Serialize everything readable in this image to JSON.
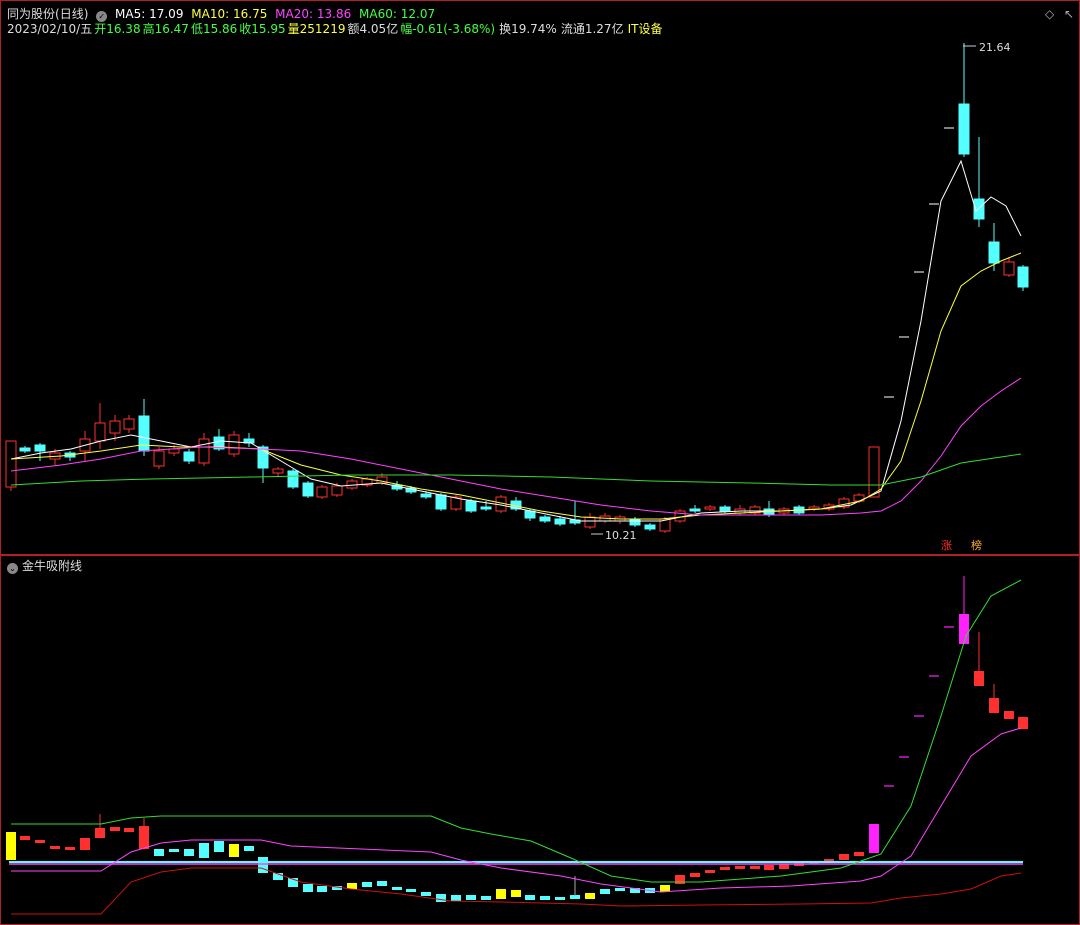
{
  "header": {
    "stock_name": "同为股份",
    "period": "(日线)",
    "ma": [
      {
        "label": "MA5: 17.09",
        "color": "#ffffff"
      },
      {
        "label": "MA10: 16.75",
        "color": "#ffff44"
      },
      {
        "label": "MA20: 13.86",
        "color": "#ff44ff"
      },
      {
        "label": "MA60: 12.07",
        "color": "#44ff44"
      }
    ]
  },
  "info_line": {
    "date": "2023/02/10/五",
    "open": "开16.38",
    "high": "高16.47",
    "low": "低15.86",
    "close": "收15.95",
    "volume": "量251219",
    "amount": "额4.05亿",
    "change": "幅-0.61(-3.68%)",
    "turnover": "换19.74%",
    "float_cap": "流通1.27亿",
    "sector": "IT设备"
  },
  "annotations": {
    "high_marker": "21.64",
    "low_marker": "10.21",
    "tag_limit_up": "涨",
    "tag_list": "榜"
  },
  "indicator": {
    "name": "金牛吸附线"
  },
  "topright_icons": [
    "diamond-icon",
    "expand-icon"
  ],
  "colors": {
    "up": "#ff3030",
    "down": "#54ffff",
    "ma5": "#ffffff",
    "ma10": "#ffff44",
    "ma20": "#ff44ff",
    "ma60": "#33dd33",
    "border": "#b0202a"
  }
}
